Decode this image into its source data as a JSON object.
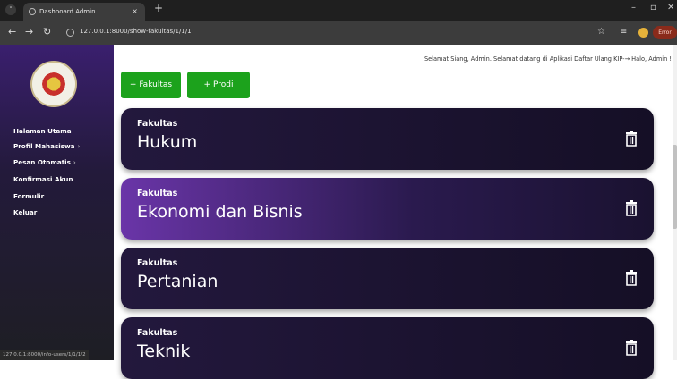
{
  "browser": {
    "tab_title": "Dashboard Admin",
    "tab_close": "×",
    "new_tab": "+",
    "url": "127.0.0.1:8000/show-fakultas/1/1/1",
    "error_label": "Error",
    "status_url": "127.0.0.1:8000/info-users/1/1/1/2"
  },
  "sidebar": {
    "items": [
      {
        "label": "Halaman Utama",
        "chevron": ""
      },
      {
        "label": "Profil Mahasiswa",
        "chevron": "›"
      },
      {
        "label": "Pesan Otomatis",
        "chevron": "›"
      },
      {
        "label": "Konfirmasi Akun",
        "chevron": ""
      },
      {
        "label": "Formulir",
        "chevron": ""
      },
      {
        "label": "Keluar",
        "chevron": ""
      }
    ]
  },
  "header": {
    "greeting": "Selamat Siang, Admin. Selamat datang di Aplikasi Daftar Ulang KIP-→ Halo, Admin !"
  },
  "actions": {
    "add_fakultas": "+ Fakultas",
    "add_prodi": "+ Prodi"
  },
  "cards": [
    {
      "label": "Fakultas",
      "name": "Hukum"
    },
    {
      "label": "Fakultas",
      "name": "Ekonomi dan Bisnis"
    },
    {
      "label": "Fakultas",
      "name": "Pertanian"
    },
    {
      "label": "Fakultas",
      "name": "Teknik"
    }
  ],
  "colors": {
    "accent_green": "#1ca21c",
    "card_dark": "#1a1230",
    "sidebar_purple": "#3a1f6e"
  }
}
